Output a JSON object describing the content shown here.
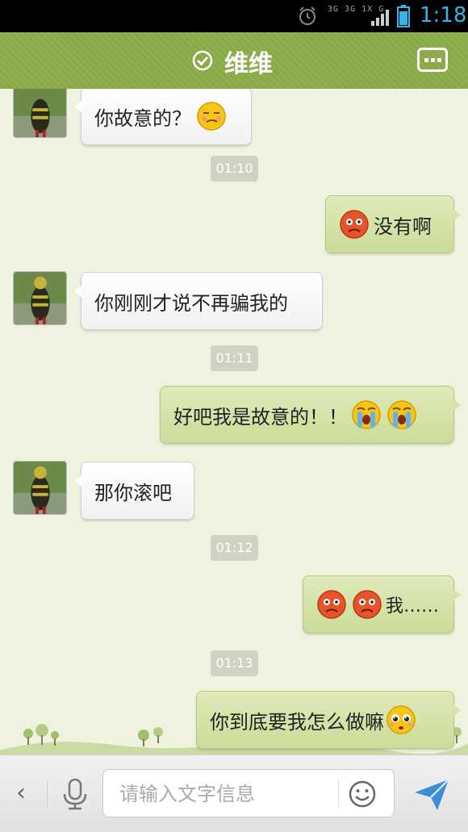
{
  "status_bar": {
    "network": [
      "3G",
      "3G",
      "1X",
      "G"
    ],
    "time": "1:18"
  },
  "header": {
    "title": "维维"
  },
  "messages": [
    {
      "side": "in",
      "text": "你故意的？",
      "emojis": [
        "smirk"
      ]
    },
    {
      "kind": "time",
      "text": "01:10"
    },
    {
      "side": "out",
      "text": "没有啊",
      "emojis": [
        "angry"
      ]
    },
    {
      "side": "in",
      "text": "你刚刚才说不再骗我的",
      "emojis": []
    },
    {
      "kind": "time",
      "text": "01:11"
    },
    {
      "side": "out",
      "text": "好吧我是故意的！！",
      "emojis": [
        "crying",
        "crying"
      ]
    },
    {
      "side": "in",
      "text": "那你滚吧",
      "emojis": []
    },
    {
      "kind": "time",
      "text": "01:12"
    },
    {
      "side": "out",
      "text": "我……",
      "emojis": [
        "angry",
        "angry"
      ]
    },
    {
      "kind": "time",
      "text": "01:13"
    },
    {
      "side": "out",
      "text": "你到底要我怎么做嘛",
      "emojis": [
        "pleading"
      ]
    }
  ],
  "input": {
    "placeholder": "请输入文字信息"
  },
  "colors": {
    "header_green": "#8fae4e",
    "bubble_out": "#d6e4ac",
    "chat_bg": "#eef2df",
    "time_color": "#33b5e5"
  }
}
